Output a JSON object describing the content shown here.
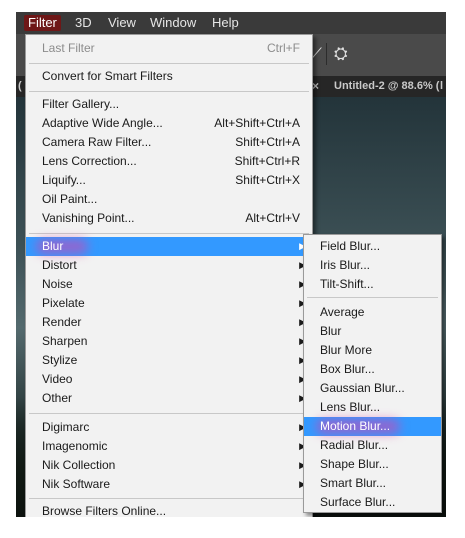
{
  "menubar": [
    "Filter",
    "3D",
    "View",
    "Window",
    "Help"
  ],
  "tabs": {
    "left_fragment": "(",
    "close_glyph": "×",
    "document": "Untitled-2 @ 88.6% (",
    "right_fragment": "l"
  },
  "options_bar": {
    "angle_icon": "⟋",
    "tool_icon": "⛭"
  },
  "filter_menu": {
    "last_filter": {
      "label": "Last Filter",
      "shortcut": "Ctrl+F"
    },
    "convert": "Convert for Smart Filters",
    "group1": [
      {
        "label": "Filter Gallery...",
        "shortcut": ""
      },
      {
        "label": "Adaptive Wide Angle...",
        "shortcut": "Alt+Shift+Ctrl+A"
      },
      {
        "label": "Camera Raw Filter...",
        "shortcut": "Shift+Ctrl+A"
      },
      {
        "label": "Lens Correction...",
        "shortcut": "Shift+Ctrl+R"
      },
      {
        "label": "Liquify...",
        "shortcut": "Shift+Ctrl+X"
      },
      {
        "label": "Oil Paint...",
        "shortcut": ""
      },
      {
        "label": "Vanishing Point...",
        "shortcut": "Alt+Ctrl+V"
      }
    ],
    "group2": [
      "Blur",
      "Distort",
      "Noise",
      "Pixelate",
      "Render",
      "Sharpen",
      "Stylize",
      "Video",
      "Other"
    ],
    "group3": [
      "Digimarc",
      "Imagenomic",
      "Nik Collection",
      "Nik Software"
    ],
    "browse": "Browse Filters Online...",
    "submenu_arrow": "▶"
  },
  "blur_menu": {
    "group1": [
      "Field Blur...",
      "Iris Blur...",
      "Tilt-Shift..."
    ],
    "group2": [
      "Average",
      "Blur",
      "Blur More",
      "Box Blur...",
      "Gaussian Blur...",
      "Lens Blur...",
      "Motion Blur...",
      "Radial Blur...",
      "Shape Blur...",
      "Smart Blur...",
      "Surface Blur..."
    ]
  },
  "highlighted": {
    "filter_item": "Blur",
    "blur_item": "Motion Blur..."
  },
  "colors": {
    "highlight": "#3399ff",
    "menu_bg": "#f2f2f2",
    "annotation_glow": "#de3caa",
    "active_menubar": "#6e1717"
  }
}
